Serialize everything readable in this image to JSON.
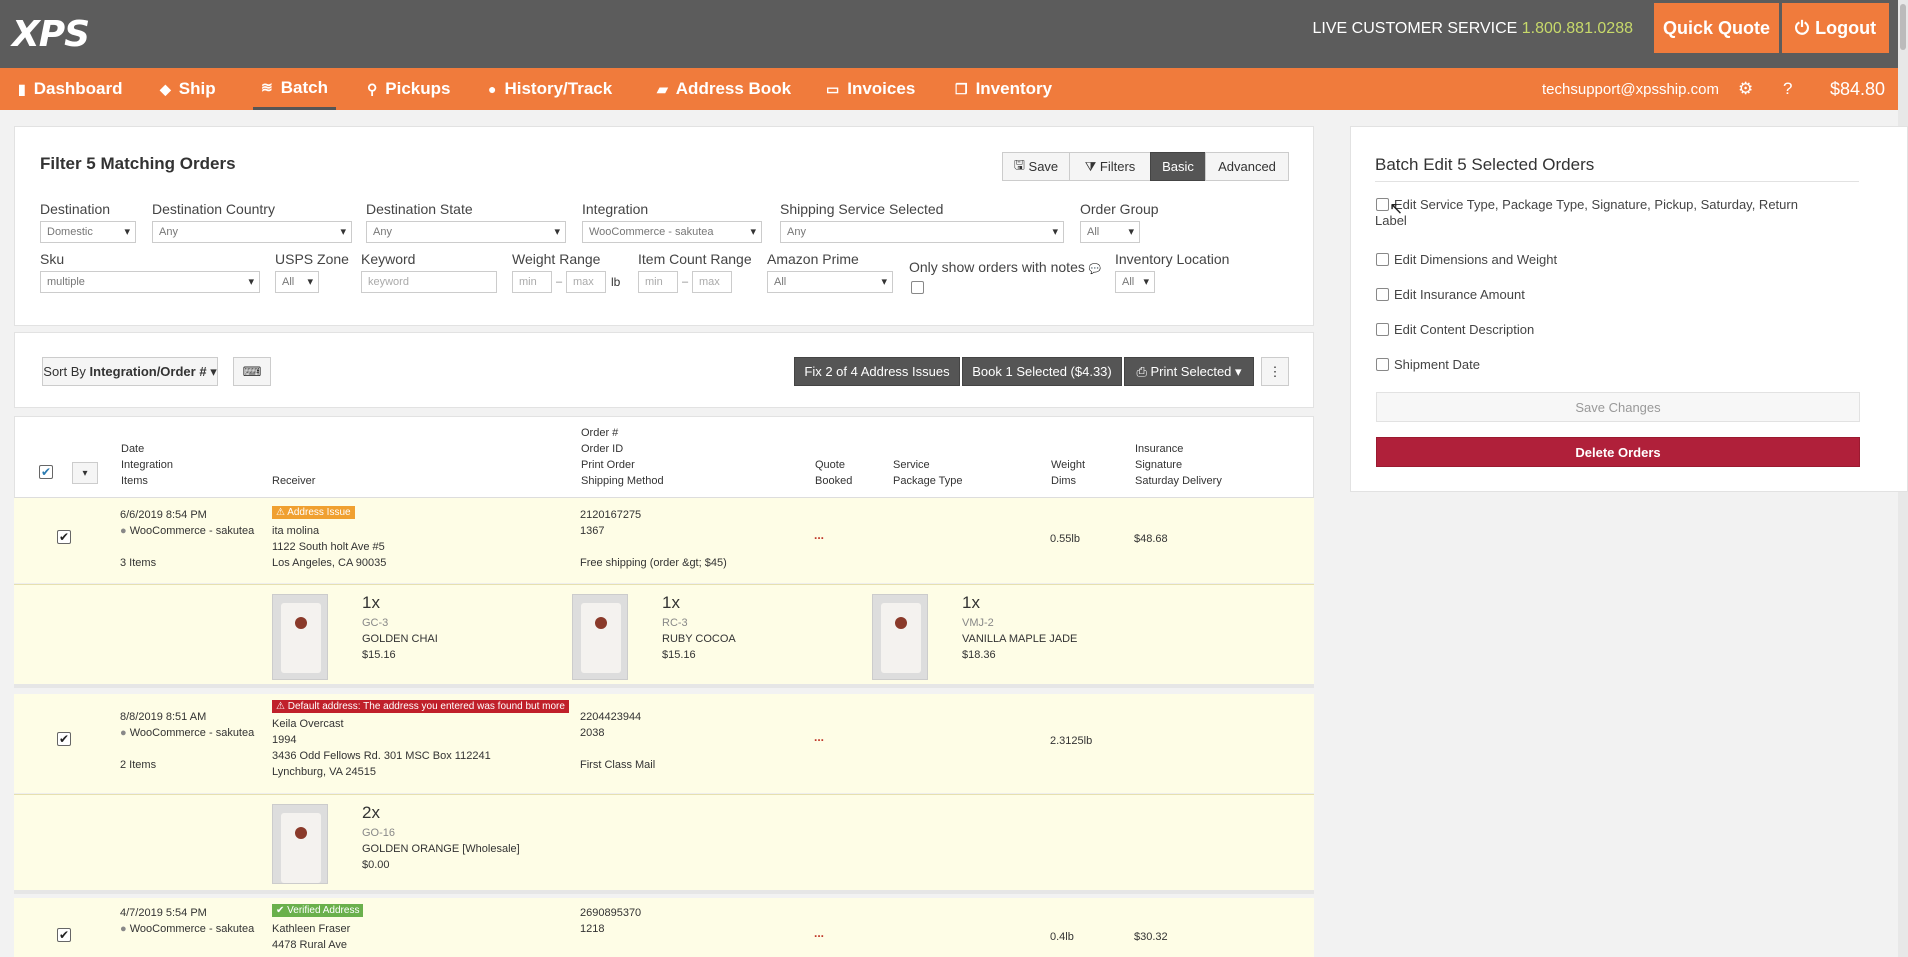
{
  "header": {
    "logo": "XPS",
    "cs_label": "LIVE CUSTOMER SERVICE",
    "cs_phone": "1.800.881.0288",
    "quick_quote": "Quick Quote",
    "logout": "Logout"
  },
  "nav": {
    "items": [
      {
        "label": "Dashboard",
        "icon": "bar-chart-icon"
      },
      {
        "label": "Ship",
        "icon": "box-icon"
      },
      {
        "label": "Batch",
        "icon": "layers-icon"
      },
      {
        "label": "Pickups",
        "icon": "map-pin-icon"
      },
      {
        "label": "History/Track",
        "icon": "globe-icon"
      },
      {
        "label": "Address Book",
        "icon": "book-icon"
      },
      {
        "label": "Invoices",
        "icon": "credit-card-icon"
      },
      {
        "label": "Inventory",
        "icon": "copy-icon"
      }
    ],
    "email": "techsupport@xpsship.com",
    "balance": "$84.80"
  },
  "filter": {
    "title": "Filter 5 Matching Orders",
    "save": "Save",
    "filters": "Filters",
    "basic": "Basic",
    "advanced": "Advanced",
    "destination": {
      "label": "Destination",
      "value": "Domestic"
    },
    "dest_country": {
      "label": "Destination Country",
      "value": "Any"
    },
    "dest_state": {
      "label": "Destination State",
      "value": "Any"
    },
    "integration": {
      "label": "Integration",
      "value": "WooCommerce - sakutea"
    },
    "service": {
      "label": "Shipping Service Selected",
      "value": "Any"
    },
    "order_group": {
      "label": "Order Group",
      "value": "All"
    },
    "sku": {
      "label": "Sku",
      "value": "multiple"
    },
    "usps_zone": {
      "label": "USPS Zone",
      "value": "All"
    },
    "keyword": {
      "label": "Keyword",
      "placeholder": "keyword"
    },
    "weight": {
      "label": "Weight Range",
      "min": "min",
      "max": "max",
      "unit": "lb",
      "dash": "–"
    },
    "items": {
      "label": "Item Count Range",
      "min": "min",
      "max": "max",
      "dash": "–"
    },
    "prime": {
      "label": "Amazon Prime",
      "value": "All"
    },
    "notes": {
      "label": "Only show orders with notes"
    },
    "inventory": {
      "label": "Inventory Location",
      "value": "All"
    }
  },
  "toolbar": {
    "sort_prefix": "Sort By",
    "sort_value": "Integration/Order #",
    "fix": "Fix 2 of 4 Address Issues",
    "book": "Book 1 Selected ($4.33)",
    "print": "Print Selected"
  },
  "table": {
    "headers": {
      "date": [
        "Date",
        "Integration",
        "Items"
      ],
      "receiver": "Receiver",
      "order": [
        "Order #",
        "Order ID",
        "Print Order",
        "Shipping Method"
      ],
      "quote": [
        "Quote",
        "Booked"
      ],
      "service": [
        "Service",
        "Package Type"
      ],
      "weight": [
        "Weight",
        "Dims"
      ],
      "insurance": [
        "Insurance",
        "Signature",
        "Saturday Delivery"
      ]
    },
    "orders": [
      {
        "date": "6/6/2019 8:54 PM",
        "integration": "WooCommerce - sakutea",
        "items": "3 Items",
        "badge": "Address Issue",
        "name": "ita molina",
        "addr1": "1122 South holt Ave #5",
        "addr2": "Los Angeles, CA 90035",
        "order_no": "2120167275",
        "order_id": "1367",
        "method": "Free shipping (order &gt; $45)",
        "quote": "...",
        "weight": "0.55lb",
        "insurance": "$48.68",
        "products": [
          {
            "qty": "1x",
            "sku": "GC-3",
            "name": "GOLDEN CHAI",
            "price": "$15.16"
          },
          {
            "qty": "1x",
            "sku": "RC-3",
            "name": "RUBY COCOA",
            "price": "$15.16"
          },
          {
            "qty": "1x",
            "sku": "VMJ-2",
            "name": "VANILLA MAPLE JADE",
            "price": "$18.36"
          }
        ]
      },
      {
        "date": "8/8/2019 8:51 AM",
        "integration": "WooCommerce - sakutea",
        "items": "2 Items",
        "badge": "Default address: The address you entered was found but more",
        "name": "Keila Overcast",
        "addr0": "1994",
        "addr1": "3436 Odd Fellows Rd. 301 MSC Box 112241",
        "addr2": "Lynchburg, VA 24515",
        "order_no": "2204423944",
        "order_id": "2038",
        "method": "First Class Mail",
        "quote": "...",
        "weight": "2.3125lb",
        "products": [
          {
            "qty": "2x",
            "sku": "GO-16",
            "name": "GOLDEN ORANGE [Wholesale]",
            "price": "$0.00"
          }
        ]
      },
      {
        "date": "4/7/2019 5:54 PM",
        "integration": "WooCommerce - sakutea",
        "badge": "Verified Address",
        "name": "Kathleen Fraser",
        "addr1": "4478 Rural Ave",
        "order_no": "2690895370",
        "order_id": "1218",
        "quote": "...",
        "weight": "0.4lb",
        "insurance": "$30.32"
      }
    ]
  },
  "batch": {
    "title": "Batch Edit 5 Selected Orders",
    "options": [
      "Edit Service Type, Package Type, Signature, Pickup, Saturday, Return",
      "Label",
      "Edit Dimensions and Weight",
      "Edit Insurance Amount",
      "Edit Content Description",
      "Shipment Date"
    ],
    "save": "Save Changes",
    "delete": "Delete Orders"
  },
  "colors": {
    "orange": "#f07b3c",
    "dark": "#5c5c5c",
    "delete": "#b0203a",
    "issue": "#f0a030",
    "error": "#c0202a",
    "verified": "#6ab04c"
  }
}
